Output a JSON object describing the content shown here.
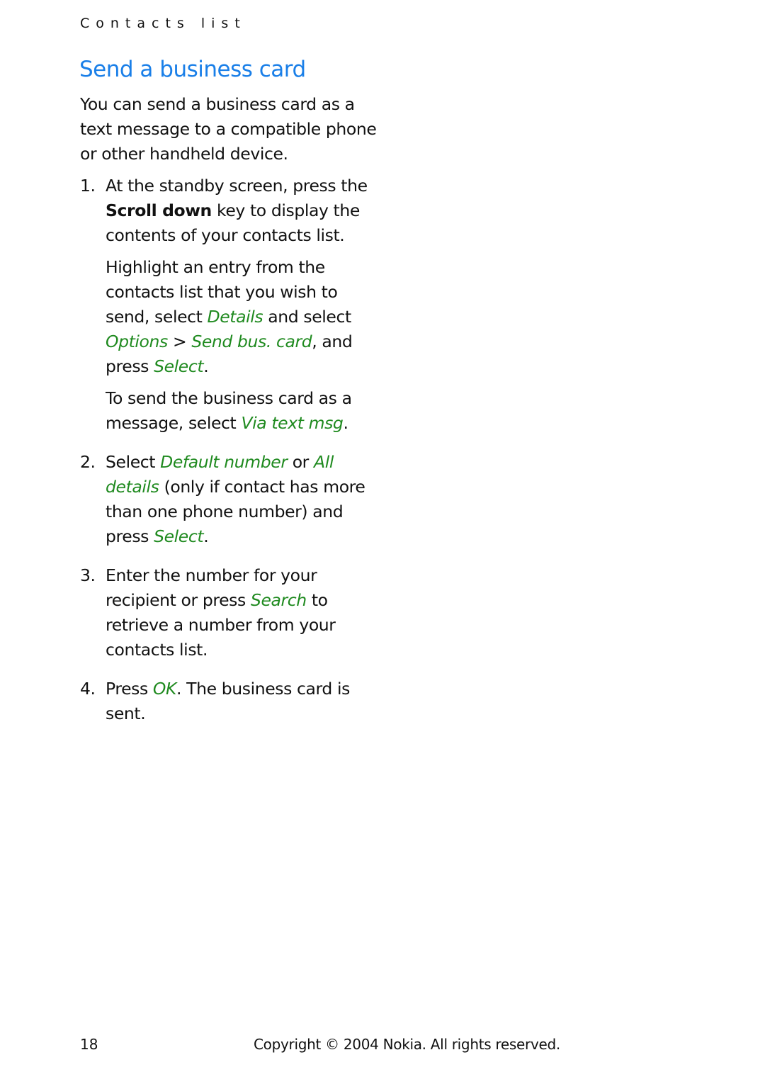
{
  "running_head": "Contacts list",
  "title": "Send a business card",
  "intro": "You can send a business card as a text message to a compatible phone or other handheld device.",
  "steps": [
    {
      "num": "1.",
      "p1": {
        "a": "At the standby screen, press the ",
        "key": "Scroll down",
        "b": " key to display the contents of your contacts list."
      },
      "p2": {
        "a": "Highlight an entry from the contacts list that you wish to send, select ",
        "ui1": "Details",
        "b": " and select ",
        "ui2": "Options",
        "c": " > ",
        "ui3": "Send bus. card",
        "d": ", and press ",
        "ui4": "Select",
        "e": "."
      },
      "p3": {
        "a": "To send the business card as a message, select ",
        "ui1": "Via text msg",
        "b": "."
      }
    },
    {
      "num": "2.",
      "p1": {
        "a": "Select ",
        "ui1": "Default number",
        "b": " or ",
        "ui2": "All details",
        "c": " (only if contact has more than one phone number) and press ",
        "ui3": "Select",
        "d": "."
      }
    },
    {
      "num": "3.",
      "p1": {
        "a": "Enter the number for your recipient or press ",
        "ui1": "Search",
        "b": " to retrieve a number from your contacts list."
      }
    },
    {
      "num": "4.",
      "p1": {
        "a": "Press ",
        "ui1": "OK",
        "b": ". The business card is sent."
      }
    }
  ],
  "footer": {
    "page_number": "18",
    "copyright": "Copyright © 2004 Nokia. All rights reserved."
  },
  "colors": {
    "title": "#1a7fe8",
    "ui_text": "#1f8a1f"
  }
}
